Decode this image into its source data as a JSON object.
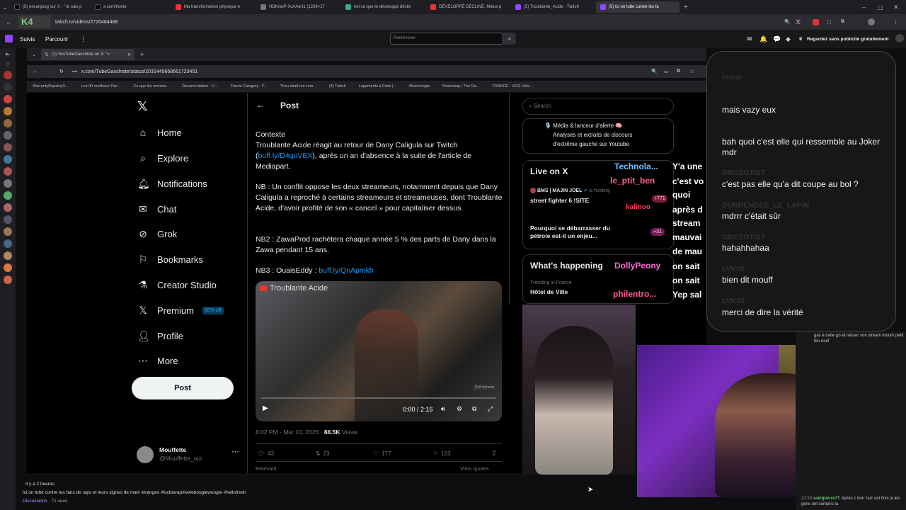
{
  "outer_tabs": [
    "(5) escargoog sur X : \" le sais p",
    "x.com/home",
    "Ma transformation physique e",
    "HDKnwP-XcAAd-I1 (1206×17",
    "est ce que le développé déclin",
    "DÉVELOPPÉ DÉCLINÉ. Mieux q",
    "(5) Troublante_Acide - Twitch",
    "(5) Ici on lutte contre les fa"
  ],
  "outer_url": "twitch.tv/videos/2720484488",
  "twitch_nav": {
    "following": "Suivis",
    "browse": "Parcourir",
    "search_placeholder": "Rechercher",
    "ad_free": "Regardez sans publicité gratuitement"
  },
  "inner_tab": "(1) YouTubeGauchiste on X: \"« ",
  "inner_url": "x.com/TubeGauchiste/status/2031445668661723451",
  "bookmarks": [
    "WarrantyRepairs|X...",
    "Les 90 meilleurs Pac...",
    "Ce que les normes...",
    "Documentation - H...",
    "Forum Category - F...",
    "Thou shalt not com...",
    "(4) Twitch",
    "Logements à Paris |...",
    "Musicologie",
    "Musicmap | The Ge...",
    "FRANCE - VICE Vide..."
  ],
  "x_nav": {
    "home": "Home",
    "explore": "Explore",
    "notifications": "Notifications",
    "chat": "Chat",
    "grok": "Grok",
    "bookmarks": "Bookmarks",
    "creator_studio": "Creator Studio",
    "premium": "Premium",
    "premium_badge": "50% off",
    "profile": "Profile",
    "more": "More",
    "post_button": "Post"
  },
  "account": {
    "name": "Mouffette",
    "handle": "@Mouffette_oui"
  },
  "post": {
    "header": "Post",
    "contexte": "Contexte",
    "p1a": "Troublante Acide réagit au retour de Dany Caligula sur Twitch (",
    "p1_link": "buff.ly/D4quVEX",
    "p1b": "), après un an d'absence à la suite de l'article de Mediapart.",
    "nb": "NB : Un conflit oppose les deux streameurs, notamment depuis que Dany Caligula a reproché à certains streameurs et streameuses, dont Troublante Acide, d'avoir profité de son « cancel » pour capitaliser dessus.",
    "nb2": "NB2 : ZawaProd rachètera chaque année 5 % des parts de Dany dans la Zawa pendant 15 ans.",
    "nb3": "NB3 : OuaisEddy : ",
    "nb3_link": "buff.ly/QnApmkh",
    "video_title": "Troublante Acide",
    "video_time": "0:00 / 2:16",
    "video_full": "Full screen",
    "timestamp": "8:02 PM · Mar 10, 2026 · ",
    "views_count": "86.5K",
    "views_label": " Views",
    "replies": "43",
    "reposts": "23",
    "likes": "177",
    "bookmarks": "123",
    "relevant": "Relevant",
    "view_quotes": "View quotes"
  },
  "x_right": {
    "search_placeholder": "Search",
    "trend_line1": "🎙️ Média & lanceur d'alerte 🧠",
    "trend_line2": "Analyses et extraits de discours",
    "trend_line3": "d'extrême gauche sur Youtube",
    "live_title": "Live on X",
    "live_host": "BMS | MAJIN JOEL",
    "live_hosting": "is hosting",
    "live_show": "street fighter 6 !SITE",
    "live_count1": "+771",
    "live_q": "Pourquoi se débarrasser du pétrole est-il un enjeu...",
    "live_count2": "+31",
    "happening_title": "What's happening",
    "trending_label": "Trending in France",
    "trend_topic": "Hôtel de Ville"
  },
  "stream_overlay_words": [
    "Technola...",
    "le_ptit_ben",
    "kalinoo",
    "DollyPeony",
    "philentro...",
    "Y'a une",
    "c'est vo",
    "quoi",
    "après d",
    "stream",
    "mauvai",
    "de mau",
    "on sait",
    "on sait",
    "Yep sal"
  ],
  "chat_overlay": [
    {
      "user": "insup",
      "msg": "mais vazy eux"
    },
    {
      "user": "",
      "msg": "bah quoi c'est elle qui ressemble au Joker mdr"
    },
    {
      "user": "GROZOTIST",
      "msg": "c'est pas elle qu'a dit coupe au bol ?"
    },
    {
      "user": "DURRENDEE_LE_LAPIN",
      "msg": "mdrrr c'était sûr"
    },
    {
      "user": "GROZOTIST",
      "msg": "hahahhahaa"
    },
    {
      "user": "LVK05",
      "msg": "bien dit mouff"
    },
    {
      "user": "LVK05",
      "msg": "merci de dire la vérité"
    }
  ],
  "twitch_chat": {
    "top_text": "gas à cette go et laisser son stream mourir petit feu osef",
    "time": "23:39",
    "user": "saintpierre77",
    "msg": "Après c bon l'arc est finis la les gens ont compris la"
  },
  "video_info": {
    "ago": "Il y a 2 heures",
    "title": "Ici on lutte contre les fans de raps et leurs signes de main étranges #fuckterapvivelebooglewoogle #hellofresh",
    "category": "Discussions",
    "views": " · 71 vues"
  },
  "colors": {
    "accent_blue": "#1d9bf0",
    "twitch_purple": "#9147ff"
  }
}
